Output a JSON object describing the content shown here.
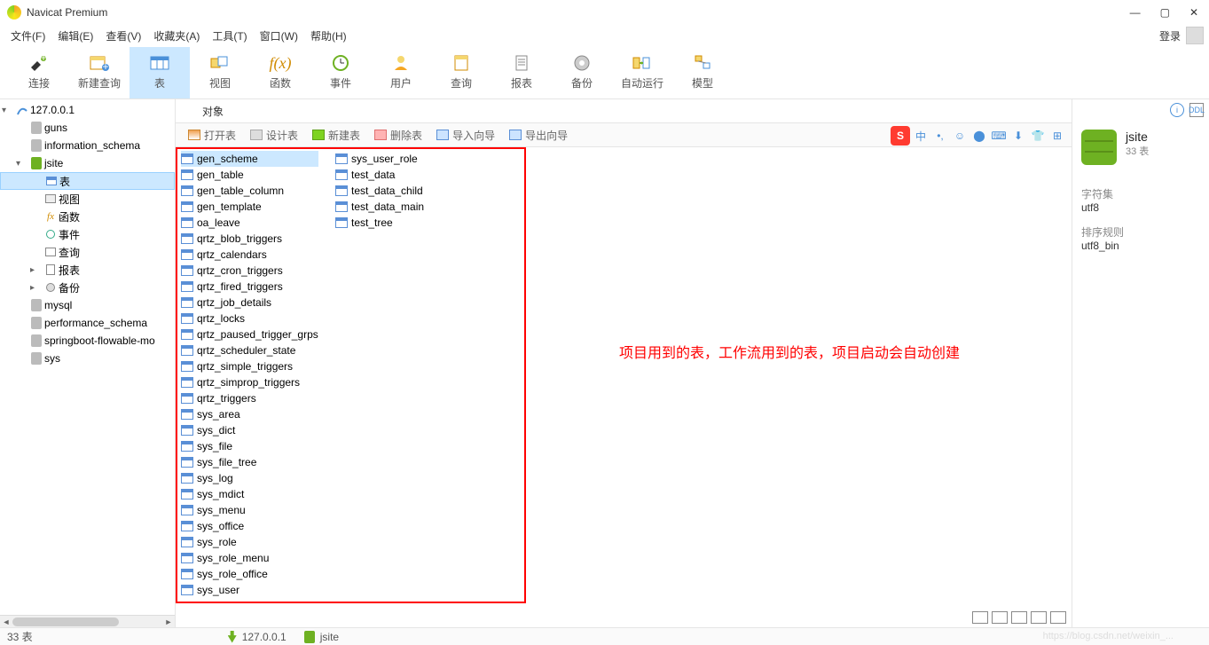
{
  "app": {
    "title": "Navicat Premium"
  },
  "win_controls": {
    "min": "—",
    "max": "▢",
    "close": "✕"
  },
  "menu": {
    "items": [
      "文件(F)",
      "编辑(E)",
      "查看(V)",
      "收藏夹(A)",
      "工具(T)",
      "窗口(W)",
      "帮助(H)"
    ],
    "login": "登录"
  },
  "toolbar": {
    "items": [
      {
        "label": "连接",
        "icon": "plug"
      },
      {
        "label": "新建查询",
        "icon": "new-query"
      },
      {
        "label": "表",
        "icon": "table",
        "active": true
      },
      {
        "label": "视图",
        "icon": "view"
      },
      {
        "label": "函数",
        "icon": "fx"
      },
      {
        "label": "事件",
        "icon": "clock"
      },
      {
        "label": "用户",
        "icon": "user"
      },
      {
        "label": "查询",
        "icon": "query"
      },
      {
        "label": "报表",
        "icon": "report"
      },
      {
        "label": "备份",
        "icon": "backup"
      },
      {
        "label": "自动运行",
        "icon": "auto"
      },
      {
        "label": "模型",
        "icon": "model"
      }
    ]
  },
  "sidebar": {
    "connection": "127.0.0.1",
    "databases": [
      {
        "name": "guns",
        "open": false
      },
      {
        "name": "information_schema",
        "open": false
      },
      {
        "name": "jsite",
        "open": true,
        "children": [
          {
            "label": "表",
            "selected": true
          },
          {
            "label": "视图"
          },
          {
            "label": "函数"
          },
          {
            "label": "事件"
          },
          {
            "label": "查询"
          },
          {
            "label": "报表"
          },
          {
            "label": "备份"
          }
        ]
      },
      {
        "name": "mysql",
        "open": false
      },
      {
        "name": "performance_schema",
        "open": false
      },
      {
        "name": "springboot-flowable-mo",
        "open": false
      },
      {
        "name": "sys",
        "open": false
      }
    ]
  },
  "object_tab": {
    "label": "对象"
  },
  "list_toolbar": {
    "open": "打开表",
    "design": "设计表",
    "new": "新建表",
    "delete": "删除表",
    "import": "导入向导",
    "export": "导出向导"
  },
  "ime_bar": {
    "badge": "S",
    "items": [
      "中",
      "•,",
      "☺",
      "⬤",
      "⌨",
      "⬇",
      "👕",
      "⊞"
    ]
  },
  "tables_col1": [
    "gen_scheme",
    "gen_table",
    "gen_table_column",
    "gen_template",
    "oa_leave",
    "qrtz_blob_triggers",
    "qrtz_calendars",
    "qrtz_cron_triggers",
    "qrtz_fired_triggers",
    "qrtz_job_details",
    "qrtz_locks",
    "qrtz_paused_trigger_grps",
    "qrtz_scheduler_state",
    "qrtz_simple_triggers",
    "qrtz_simprop_triggers",
    "qrtz_triggers",
    "sys_area",
    "sys_dict",
    "sys_file",
    "sys_file_tree",
    "sys_log",
    "sys_mdict",
    "sys_menu",
    "sys_office",
    "sys_role",
    "sys_role_menu",
    "sys_role_office",
    "sys_user"
  ],
  "tables_col2": [
    "sys_user_role",
    "test_data",
    "test_data_child",
    "test_data_main",
    "test_tree"
  ],
  "annotation": "项目用到的表，工作流用到的表，项目启动会自动创建",
  "info_panel": {
    "name": "jsite",
    "count": "33 表",
    "charset_label": "字符集",
    "charset": "utf8",
    "collation_label": "排序规则",
    "collation": "utf8_bin",
    "info_icon": "i",
    "ddl_icon": "DDL"
  },
  "statusbar": {
    "count": "33 表",
    "host": "127.0.0.1",
    "db": "jsite"
  },
  "watermark_text": "https://blog.csdn.net/weixin_..."
}
